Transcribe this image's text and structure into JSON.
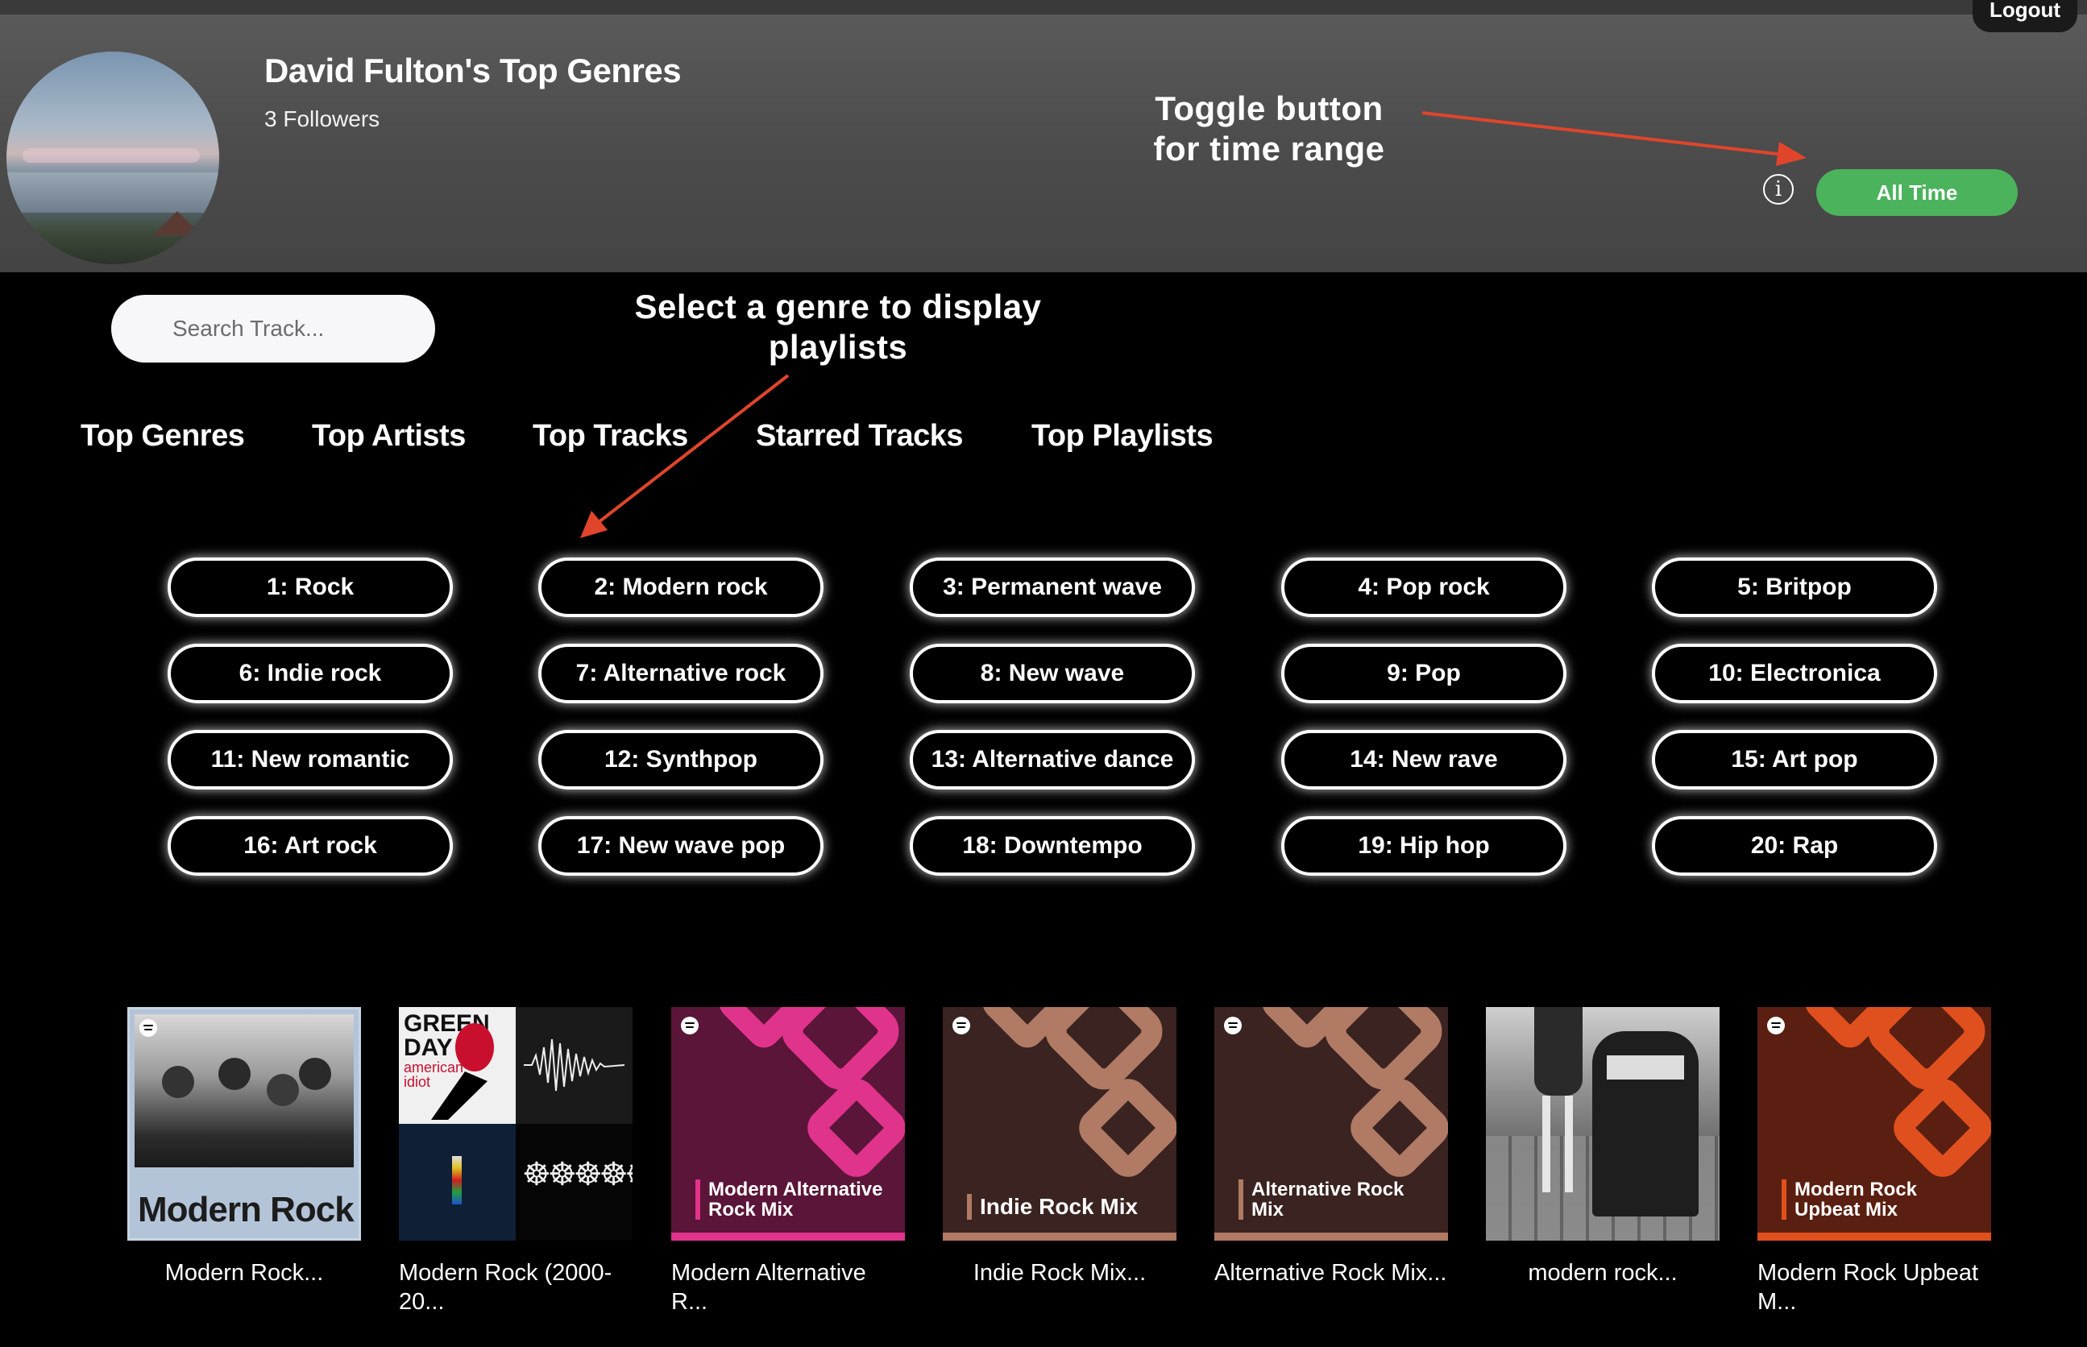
{
  "header": {
    "logout_label": "Logout",
    "title": "David Fulton's Top Genres",
    "followers": "3 Followers",
    "info_symbol": "i",
    "time_range_label": "All Time",
    "toggle_color": "#4bb35c"
  },
  "annotations": {
    "toggle_line1": "Toggle button",
    "toggle_line2": "for time range",
    "select_line1": "Select a genre to display",
    "select_line2": "playlists",
    "arrow_color": "#e0452b"
  },
  "search": {
    "placeholder": "Search Track..."
  },
  "tabs": [
    "Top Genres",
    "Top Artists",
    "Top Tracks",
    "Starred Tracks",
    "Top Playlists"
  ],
  "genres": [
    "1: Rock",
    "2: Modern rock",
    "3: Permanent wave",
    "4: Pop rock",
    "5: Britpop",
    "6: Indie rock",
    "7: Alternative rock",
    "8: New wave",
    "9: Pop",
    "10: Electronica",
    "11: New romantic",
    "12: Synthpop",
    "13: Alternative dance",
    "14: New rave",
    "15: Art pop",
    "16: Art rock",
    "17: New wave pop",
    "18: Downtempo",
    "19: Hip hop",
    "20: Rap"
  ],
  "playlists": [
    {
      "label": "Modern Rock...",
      "cover_text": "Modern Rock"
    },
    {
      "label": "Modern Rock (2000-20...",
      "cover_text_1": "GREEN",
      "cover_text_2": "DAY",
      "cover_text_3": "american",
      "cover_text_4": "idiot"
    },
    {
      "label": "Modern Alternative R...",
      "cover_text_1": "Modern Alternative",
      "cover_text_2": "Rock Mix",
      "color": "#5a1538",
      "accent": "#e0338c"
    },
    {
      "label": "Indie Rock Mix...",
      "cover_text_1": "Indie Rock Mix",
      "color": "#3a2320",
      "accent": "#b07a64"
    },
    {
      "label": "Alternative Rock Mix...",
      "cover_text_1": "Alternative Rock",
      "cover_text_2": "Mix",
      "color": "#3a2320",
      "accent": "#b07a64"
    },
    {
      "label": "modern rock...",
      "cover_text": ""
    },
    {
      "label": "Modern Rock Upbeat M...",
      "cover_text_1": "Modern Rock",
      "cover_text_2": "Upbeat Mix",
      "color": "#5a1f10",
      "accent": "#e0501e"
    }
  ]
}
